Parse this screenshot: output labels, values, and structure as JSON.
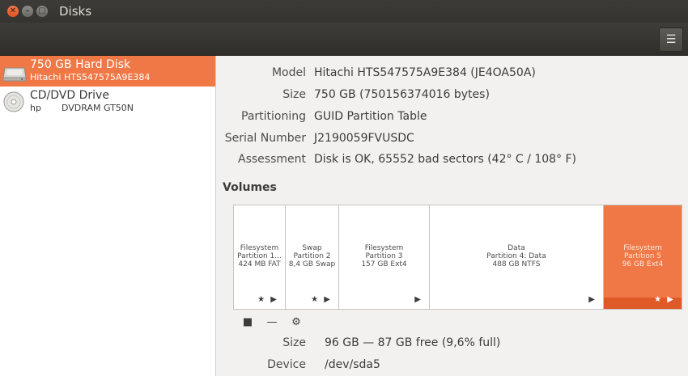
{
  "window": {
    "title": "Disks",
    "controls": {
      "close": "close-icon",
      "minimize": "minimize-icon",
      "maximize": "maximize-icon"
    }
  },
  "toolbar": {
    "menu_icon": "hamburger-menu-icon"
  },
  "sidebar": {
    "drives": [
      {
        "name": "750 GB Hard Disk",
        "subtitle": "Hitachi HTS547575A9E384",
        "icon": "hard-disk-icon",
        "selected": true
      },
      {
        "name": "CD/DVD Drive",
        "vendor": "hp",
        "model": "DVDRAM GT50N",
        "icon": "optical-disc-icon",
        "selected": false
      }
    ]
  },
  "details": {
    "model_label": "Model",
    "model_value": "Hitachi HTS547575A9E384 (JE4OA50A)",
    "size_label": "Size",
    "size_value": "750 GB (750156374016 bytes)",
    "partitioning_label": "Partitioning",
    "partitioning_value": "GUID Partition Table",
    "serial_label": "Serial Number",
    "serial_value": "J2190059FVUSDC",
    "assessment_label": "Assessment",
    "assessment_value": "Disk is OK, 65552 bad sectors (42° C / 108° F)"
  },
  "volumes": {
    "heading": "Volumes",
    "partitions": [
      {
        "line1": "Filesystem",
        "line2": "Partition 1...",
        "line3": "424 MB FAT",
        "icons": "★ ▶",
        "selected": false
      },
      {
        "line1": "Swap",
        "line2": "Partition 2",
        "line3": "8,4 GB Swap",
        "icons": "★ ▶",
        "selected": false
      },
      {
        "line1": "Filesystem",
        "line2": "Partition 3",
        "line3": "157 GB Ext4",
        "icons": "▶",
        "selected": false
      },
      {
        "line1": "Data",
        "line2": "Partition 4: Data",
        "line3": "488 GB NTFS",
        "icons": "▶",
        "selected": false
      },
      {
        "line1": "Filesystem",
        "line2": "Partition 5",
        "line3": "96 GB Ext4",
        "icons": "★ ▶",
        "selected": true
      }
    ],
    "tools": {
      "stop": "stop-icon",
      "remove": "minus-icon",
      "settings": "gears-icon"
    }
  },
  "selected_volume": {
    "size_label": "Size",
    "size_value": "96 GB — 87 GB free (9,6% full)",
    "device_label": "Device",
    "device_value": "/dev/sda5"
  },
  "colors": {
    "accent": "#f07746",
    "titlebar": "#3c3b37",
    "sidebar_bg": "#ffffff",
    "content_bg": "#f2f1f0"
  }
}
